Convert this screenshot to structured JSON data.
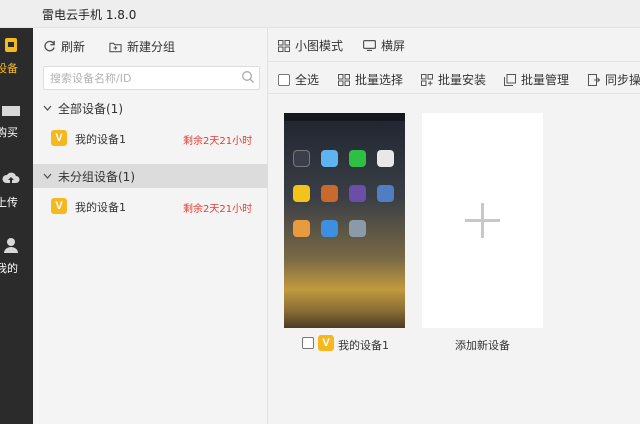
{
  "window": {
    "title": "雷电云手机 1.8.0"
  },
  "rail": {
    "items": [
      {
        "label": "设备",
        "icon": "device-icon",
        "active": true
      },
      {
        "label": "购买",
        "icon": "cart-icon",
        "active": false
      },
      {
        "label": "上传",
        "icon": "cloud-upload-icon",
        "active": false
      },
      {
        "label": "我的",
        "icon": "user-icon",
        "active": false
      }
    ],
    "accent": "#f5b81f"
  },
  "panel": {
    "refresh_label": "刷新",
    "new_group_label": "新建分组",
    "search_placeholder": "搜索设备名称/ID",
    "groups": [
      {
        "label": "全部设备(1)",
        "devices": [
          {
            "badge": "V",
            "name": "我的设备1",
            "remaining": "剩余2天21小时"
          }
        ]
      },
      {
        "label": "未分组设备(1)",
        "devices": [
          {
            "badge": "V",
            "name": "我的设备1",
            "remaining": "剩余2天21小时"
          }
        ]
      }
    ]
  },
  "main": {
    "toolbar1": {
      "small_mode_label": "小图模式",
      "landscape_label": "横屏"
    },
    "toolbar2": {
      "select_all_label": "全选",
      "batch_select_label": "批量选择",
      "batch_install_label": "批量安装",
      "batch_manage_label": "批量管理",
      "sync_label": "同步操"
    },
    "device_card": {
      "badge": "V",
      "name": "我的设备1"
    },
    "add_card": {
      "label": "添加新设备"
    }
  }
}
